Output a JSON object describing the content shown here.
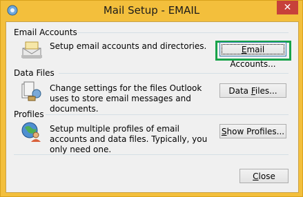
{
  "window": {
    "title": "Mail Setup - EMAIL",
    "close_glyph": "✕"
  },
  "sections": [
    {
      "label": "Email Accounts",
      "description": "Setup email accounts and directories.",
      "button": {
        "pre": "",
        "u": "E",
        "post": "mail Accounts..."
      },
      "icon": "email-accounts-icon"
    },
    {
      "label": "Data Files",
      "description": "Change settings for the files Outlook uses to store email messages and documents.",
      "button": {
        "pre": "Data ",
        "u": "F",
        "post": "iles..."
      },
      "icon": "data-files-icon"
    },
    {
      "label": "Profiles",
      "description": "Setup multiple profiles of email accounts and data files. Typically, you only need one.",
      "button": {
        "pre": "",
        "u": "S",
        "post": "how Profiles..."
      },
      "icon": "profiles-icon"
    }
  ],
  "close_button": {
    "pre": "",
    "u": "C",
    "post": "lose"
  },
  "colors": {
    "frame": "#f3bf3c",
    "close": "#c7413a",
    "highlight": "#17a34a",
    "panel": "#f0f0f0"
  }
}
